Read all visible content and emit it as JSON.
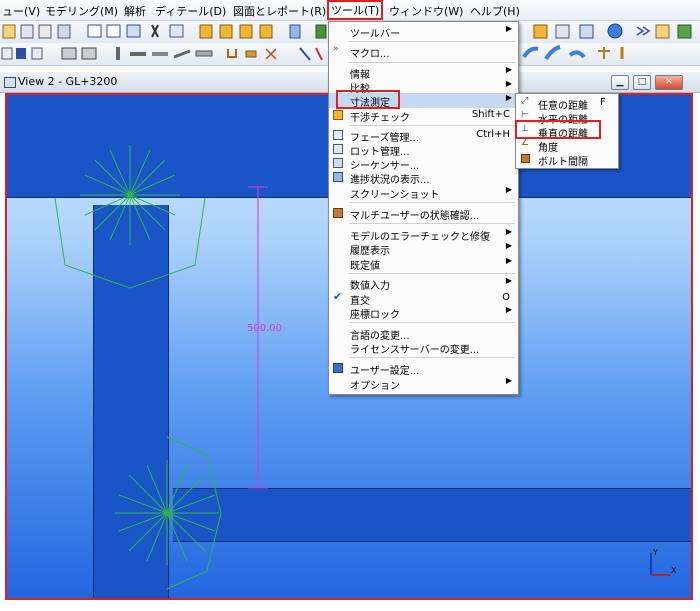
{
  "menubar": {
    "items": [
      "ュー(V)",
      "モデリング(M)",
      "解析",
      "ディテール(D)",
      "図面とレポート(R)",
      "ツール(T)",
      "ウィンドウ(W)",
      "ヘルプ(H)"
    ]
  },
  "view": {
    "title": "View 2 - GL+3200",
    "dimension_label": "500.00"
  },
  "tools_menu": {
    "items": [
      {
        "label": "ツールバー",
        "submenu": true
      },
      {
        "label": "マクロ..."
      },
      {
        "label": "情報",
        "submenu": true
      },
      {
        "label": "比較",
        "submenu": true
      },
      {
        "label": "寸法測定",
        "submenu": true
      },
      {
        "label": "干渉チェック",
        "shortcut": "Shift+C"
      },
      {
        "label": "フェーズ管理...",
        "shortcut": "Ctrl+H"
      },
      {
        "label": "ロット管理..."
      },
      {
        "label": "シーケンサー..."
      },
      {
        "label": "進捗状況の表示..."
      },
      {
        "label": "スクリーンショット",
        "submenu": true
      },
      {
        "label": "マルチユーザーの状態確認..."
      },
      {
        "label": "モデルのエラーチェックと修復",
        "submenu": true
      },
      {
        "label": "履歴表示",
        "submenu": true
      },
      {
        "label": "既定値",
        "submenu": true
      },
      {
        "label": "数値入力",
        "submenu": true
      },
      {
        "label": "直交",
        "shortcut": "O"
      },
      {
        "label": "座標ロック",
        "submenu": true
      },
      {
        "label": "言語の変更..."
      },
      {
        "label": "ライセンスサーバーの変更..."
      },
      {
        "label": "ユーザー設定..."
      },
      {
        "label": "オプション",
        "submenu": true
      }
    ]
  },
  "measure_submenu": {
    "items": [
      {
        "label": "任意の距離",
        "shortcut": "F"
      },
      {
        "label": "水平の距離"
      },
      {
        "label": "垂直の距離"
      },
      {
        "label": "角度"
      },
      {
        "label": "ボルト間隔"
      }
    ]
  },
  "colors": {
    "highlight_box": "#e0201c",
    "steel": "#1a55c8",
    "dimension": "#d63ad6"
  }
}
